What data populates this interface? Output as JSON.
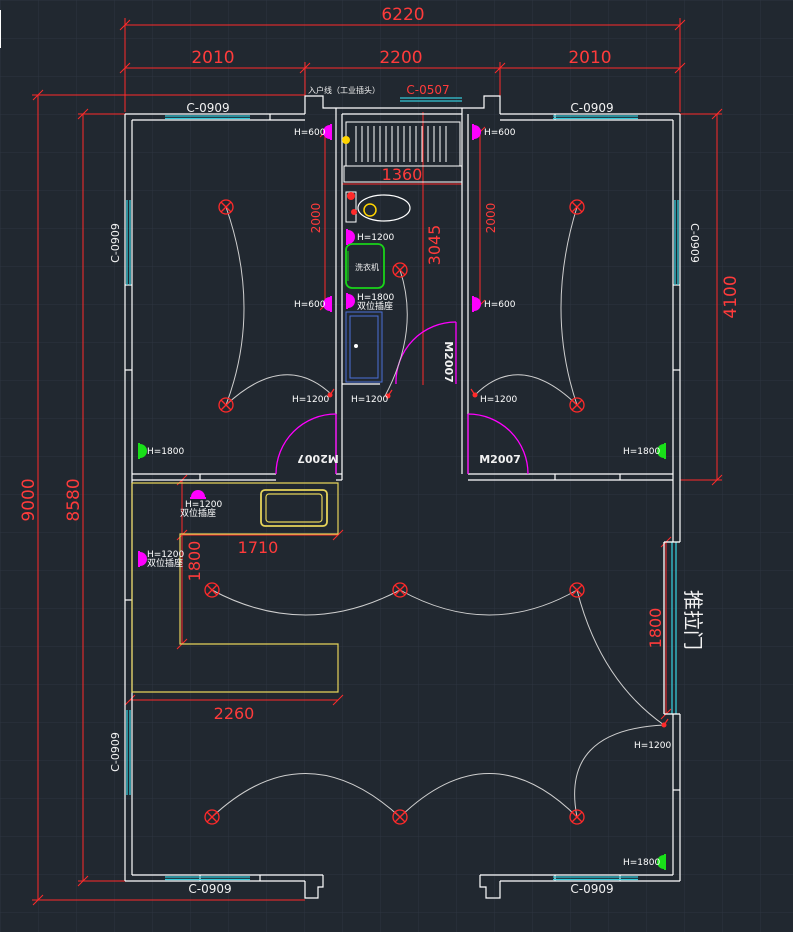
{
  "dimensions": {
    "overall_width": "6220",
    "seg_left": "2010",
    "seg_middle": "2200",
    "seg_right": "2010",
    "height_total": "9000",
    "height_inner": "8580",
    "right_upper": "4100",
    "bath_width": "1360",
    "bath_height": "3045",
    "left_wall_2000": "2000",
    "right_wall_2000": "2000",
    "kitchen_top": "1710",
    "kitchen_side": "1800",
    "kitchen_bottom": "2260",
    "sliding_door_width": "1800"
  },
  "windows": {
    "top_left": "C-0909",
    "top_right": "C-0909",
    "bath_top": "C-0507",
    "left_upper": "C-0909",
    "right_upper": "C-0909",
    "left_lower": "C-0909",
    "bottom_left": "C-0909",
    "bottom_right": "C-0909"
  },
  "doors": {
    "left_room": "M2007",
    "right_room": "M2007",
    "bathroom": "M2007",
    "sliding_door_label": "推拉门"
  },
  "labels": {
    "entry_line": "入户线（工业插头）",
    "washer": "洗衣机",
    "double_socket": "双位插座"
  },
  "sockets": {
    "h600": "H=600",
    "h1200": "H=1200",
    "h1800": "H=1800"
  },
  "colors": {
    "background": "#212830",
    "dimension": "#ff2a2a",
    "wall": "#ffffff",
    "window": "#35c8d8",
    "door_arc": "#ff00ff",
    "green_socket": "#00ff00",
    "kitchen": "#e6d35a",
    "wiring": "#cfcfcf",
    "lamp": "#ff2a2a"
  }
}
